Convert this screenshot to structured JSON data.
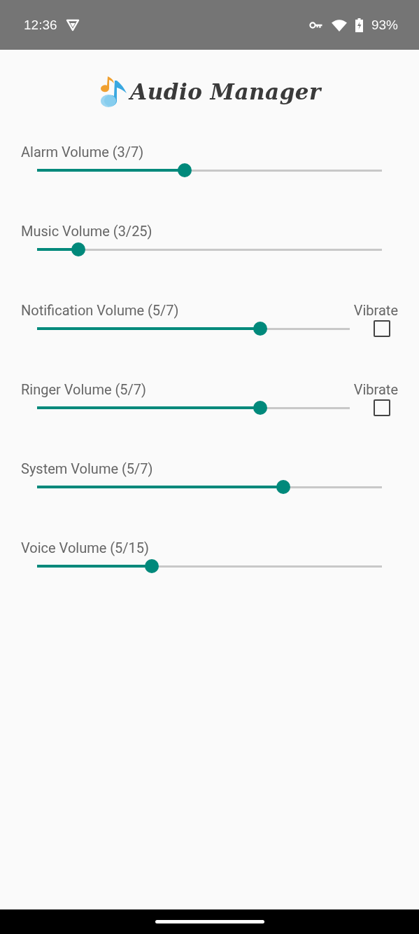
{
  "status_bar": {
    "time": "12:36",
    "battery": "93%"
  },
  "app_title": "Audio Manager",
  "volumes": [
    {
      "label": "Alarm Volume (3/7)",
      "level": 0.4286
    },
    {
      "label": "Music Volume (3/25)",
      "level": 0.12
    },
    {
      "label": "Notification Volume (5/7)",
      "level": 0.7143,
      "vibrate": {
        "label": "Vibrate",
        "checked": false
      }
    },
    {
      "label": "Ringer Volume (5/7)",
      "level": 0.7143,
      "vibrate": {
        "label": "Vibrate",
        "checked": false
      }
    },
    {
      "label": "System Volume (5/7)",
      "level": 0.7143
    },
    {
      "label": "Voice Volume (5/15)",
      "level": 0.3333
    }
  ]
}
